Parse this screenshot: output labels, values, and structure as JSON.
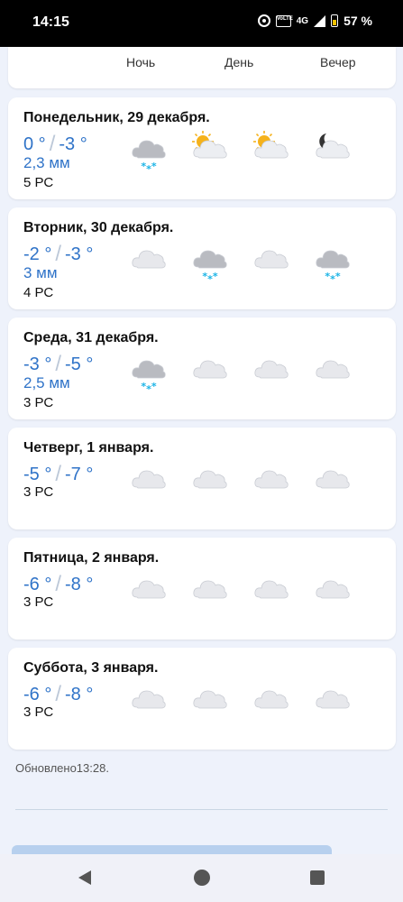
{
  "status_bar": {
    "time": "14:15",
    "volte": "VoLTE",
    "network": "4G",
    "battery": "57 %"
  },
  "columns": {
    "night": "Ночь",
    "day": "День",
    "evening": "Вечер"
  },
  "days": [
    {
      "name": "Понедельник, 29 декабря.",
      "t_high": "0 °",
      "t_low": "-3 °",
      "precip": "2,3  мм",
      "wind": "5 РС",
      "icons": [
        "cloud-snow-icon",
        "partly-sunny-icon",
        "partly-sunny-icon",
        "cloud-moon-icon"
      ]
    },
    {
      "name": "Вторник, 30 декабря.",
      "t_high": "-2 °",
      "t_low": "-3 °",
      "precip": "3  мм",
      "wind": "4 РС",
      "icons": [
        "cloud-icon",
        "cloud-snow-icon",
        "cloud-icon",
        "cloud-snow-icon"
      ]
    },
    {
      "name": "Среда, 31 декабря.",
      "t_high": "-3 °",
      "t_low": "-5 °",
      "precip": "2,5  мм",
      "wind": "3 РС",
      "icons": [
        "cloud-snow-icon",
        "cloud-icon",
        "cloud-icon",
        "cloud-icon"
      ]
    },
    {
      "name": "Четверг, 1 января.",
      "t_high": "-5 °",
      "t_low": "-7 °",
      "precip": "",
      "wind": "3 РС",
      "icons": [
        "cloud-icon",
        "cloud-icon",
        "cloud-icon",
        "cloud-icon"
      ]
    },
    {
      "name": "Пятница, 2 января.",
      "t_high": "-6 °",
      "t_low": "-8 °",
      "precip": "",
      "wind": "3 РС",
      "icons": [
        "cloud-icon",
        "cloud-icon",
        "cloud-icon",
        "cloud-icon"
      ]
    },
    {
      "name": "Суббота, 3 января.",
      "t_high": "-6 °",
      "t_low": "-8 °",
      "precip": "",
      "wind": "3 РС",
      "icons": [
        "cloud-icon",
        "cloud-icon",
        "cloud-icon",
        "cloud-icon"
      ]
    }
  ],
  "footer": {
    "updated": "Обновлено13:28."
  },
  "colors": {
    "temp_blue": "#2f73c8",
    "snow_cyan": "#19b3e6",
    "sun_yellow": "#f5b21c",
    "card_bg": "#ffffff",
    "page_bg": "#eef2fb"
  }
}
